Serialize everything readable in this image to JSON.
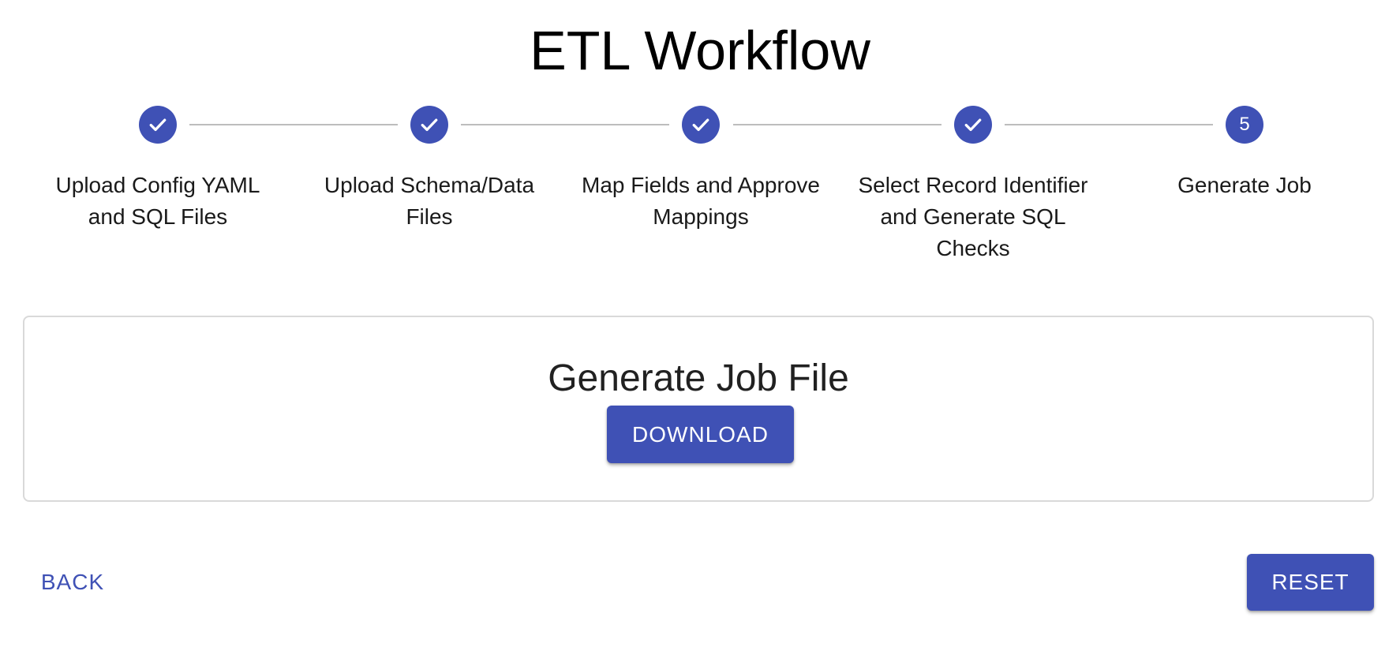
{
  "page": {
    "title": "ETL Workflow"
  },
  "stepper": {
    "active_step": 5,
    "accent_color": "#3f51b5",
    "steps": [
      {
        "label": "Upload Config YAML and SQL Files",
        "status": "completed",
        "icon": "check-icon"
      },
      {
        "label": "Upload Schema/Data Files",
        "status": "completed",
        "icon": "check-icon"
      },
      {
        "label": "Map Fields and Approve Mappings",
        "status": "completed",
        "icon": "check-icon"
      },
      {
        "label": "Select Record Identifier and Generate SQL Checks",
        "status": "completed",
        "icon": "check-icon"
      },
      {
        "label": "Generate Job",
        "status": "active",
        "number": "5"
      }
    ]
  },
  "card": {
    "title": "Generate Job File",
    "download_label": "DOWNLOAD"
  },
  "footer": {
    "back_label": "BACK",
    "reset_label": "RESET"
  }
}
